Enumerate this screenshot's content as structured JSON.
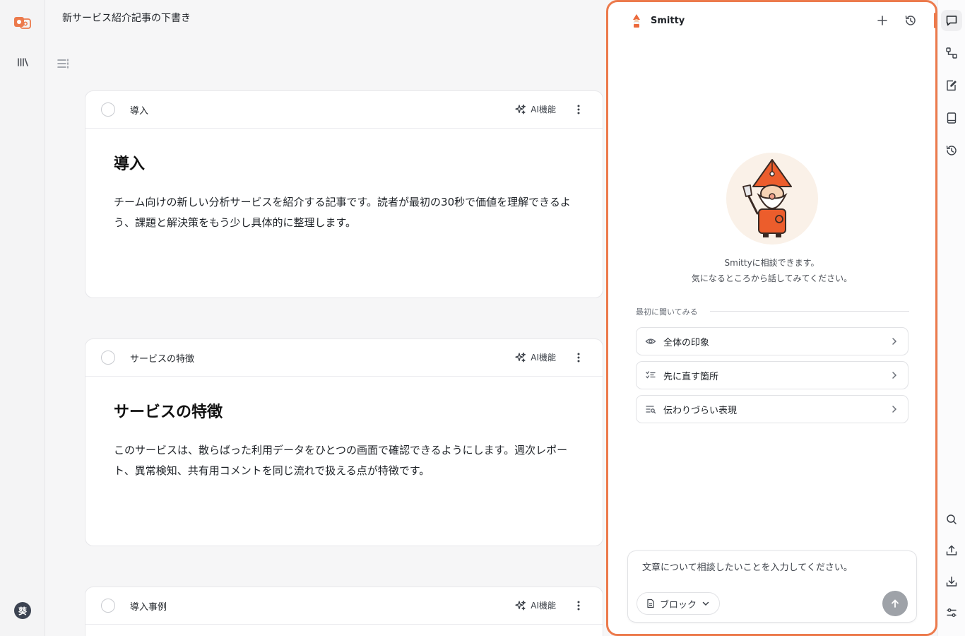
{
  "app": {
    "document_title": "新サービス紹介記事の下書き",
    "user_initial": "葵",
    "accent_color": "#ec7a4c"
  },
  "left_rail": {
    "icons": [
      "app-logo-icon",
      "library-icon"
    ]
  },
  "blocks": [
    {
      "label": "導入",
      "ai_label": "AI機能",
      "heading": "導入",
      "body": "チーム向けの新しい分析サービスを紹介する記事です。読者が最初の30秒で価値を理解できるよう、課題と解決策をもう少し具体的に整理します。"
    },
    {
      "label": "サービスの特徴",
      "ai_label": "AI機能",
      "heading": "サービスの特徴",
      "body": "このサービスは、散らばった利用データをひとつの画面で確認できるようにします。週次レポート、異常検知、共有用コメントを同じ流れで扱える点が特徴です。"
    },
    {
      "label": "導入事例",
      "ai_label": "AI機能"
    }
  ],
  "assistant": {
    "name": "Smitty",
    "intro_line1": "Smittyに相談できます。",
    "intro_line2": "気になるところから話してみてください。",
    "prompt_section_label": "最初に聞いてみる",
    "suggestions": [
      {
        "label": "全体の印象",
        "icon": "eye-icon"
      },
      {
        "label": "先に直す箇所",
        "icon": "checklist-icon"
      },
      {
        "label": "伝わりづらい表現",
        "icon": "text-search-icon"
      }
    ],
    "composer": {
      "placeholder": "文章について相談したいことを入力してください。",
      "scope_label": "ブロック"
    }
  },
  "right_rail": {
    "icons": [
      "chat-icon",
      "flow-icon",
      "edit-note-icon",
      "book-icon",
      "history-icon",
      "search-icon",
      "upload-icon",
      "download-icon",
      "settings-sliders-icon"
    ],
    "active": "chat-icon"
  }
}
